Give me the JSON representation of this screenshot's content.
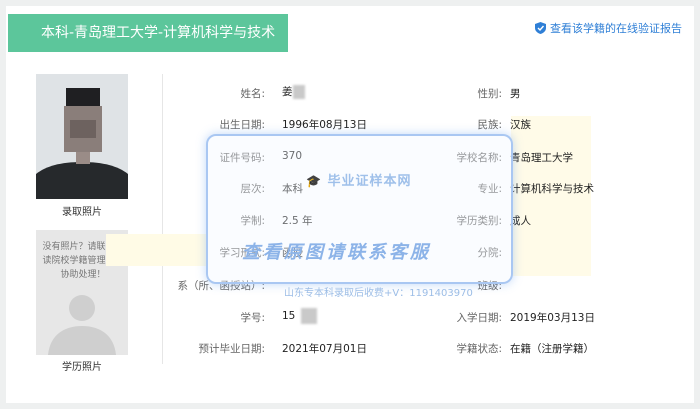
{
  "header": {
    "title": "本科-青岛理工大学-计算机科学与技术",
    "verify_link": "查看该学籍的在线验证报告",
    "verify_icon": "shield-check-icon",
    "accent": "#5cc69b",
    "link_color": "#2f7fd6"
  },
  "photos": {
    "admission_caption": "录取照片",
    "education_caption": "学历照片",
    "no_photo_text": "没有照片？请联系就读院校学籍管理部门协助处理！"
  },
  "fields": {
    "name_label": "姓名:",
    "name_value": "姜",
    "gender_label": "性别:",
    "gender_value": "男",
    "birth_label": "出生日期:",
    "birth_value": "1996年08月13日",
    "ethnicity_label": "民族:",
    "ethnicity_value": "汉族",
    "id_label": "证件号码:",
    "id_value": "370",
    "school_label": "学校名称:",
    "school_value": "青岛理工大学",
    "level_label": "层次:",
    "level_value": "本科",
    "major_label": "专业:",
    "major_value": "计算机科学与技术",
    "duration_label": "学制:",
    "duration_value": "2.5 年",
    "edu_type_label": "学历类别:",
    "edu_type_value": "成人",
    "form_label": "学习形式:",
    "form_value": "函授",
    "branch_label": "分院:",
    "branch_value": "",
    "dept_label": "系（所、函授站）:",
    "class_label": "班级:",
    "class_value": "",
    "student_no_label": "学号:",
    "student_no_value": "15",
    "enroll_label": "入学日期:",
    "enroll_value": "2019年03月13日",
    "grad_label": "预计毕业日期:",
    "grad_value": "2021年07月01日",
    "status_label": "学籍状态:",
    "status_value": "在籍（注册学籍）"
  },
  "overlay": {
    "logo_text": "毕业证样本网",
    "big_text": "查看原图请联系客服",
    "small_text": "山东专本科录取后收费+V：1191403970"
  }
}
